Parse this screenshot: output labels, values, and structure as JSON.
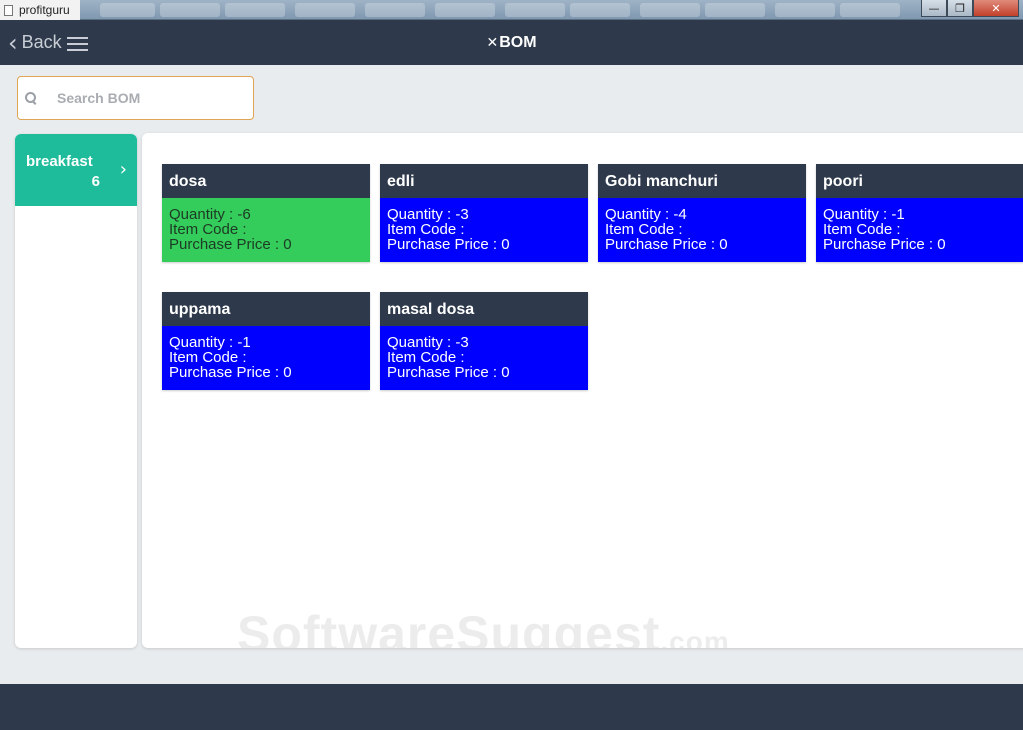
{
  "window": {
    "title": "profitguru",
    "controls": {
      "minimize": "—",
      "restore": "❐",
      "close": "✕"
    }
  },
  "header": {
    "back_label": "Back",
    "back_icon": "chevron-left-icon",
    "menu_icon": "hamburger-menu-icon",
    "title_glyph": "✕",
    "title": "BOM"
  },
  "search": {
    "placeholder": "Search BOM",
    "value": ""
  },
  "sidebar": {
    "categories": [
      {
        "name": "breakfast",
        "count": "6"
      }
    ]
  },
  "items": [
    {
      "name": "dosa",
      "quantity": "Quantity : -6",
      "item_code": "Item Code :",
      "purchase_price": "Purchase Price : 0",
      "color": "#34cc5b"
    },
    {
      "name": "edli",
      "quantity": "Quantity : -3",
      "item_code": "Item Code :",
      "purchase_price": "Purchase Price : 0",
      "color": "#0000ff"
    },
    {
      "name": "Gobi manchuri",
      "quantity": "Quantity : -4",
      "item_code": "Item Code :",
      "purchase_price": "Purchase Price : 0",
      "color": "#0000ff"
    },
    {
      "name": "poori",
      "quantity": "Quantity : -1",
      "item_code": "Item Code :",
      "purchase_price": "Purchase Price : 0",
      "color": "#0000ff"
    },
    {
      "name": "uppama",
      "quantity": "Quantity : -1",
      "item_code": "Item Code :",
      "purchase_price": "Purchase Price : 0",
      "color": "#0000ff"
    },
    {
      "name": "masal dosa",
      "quantity": "Quantity : -3",
      "item_code": "Item Code :",
      "purchase_price": "Purchase Price : 0",
      "color": "#0000ff"
    }
  ],
  "watermark": {
    "text": "SoftwareSuggest",
    "suffix": ".com"
  },
  "colors": {
    "header_bg": "#2e3a4b",
    "category_bg": "#1fbc9c",
    "search_border": "#e0a456"
  }
}
